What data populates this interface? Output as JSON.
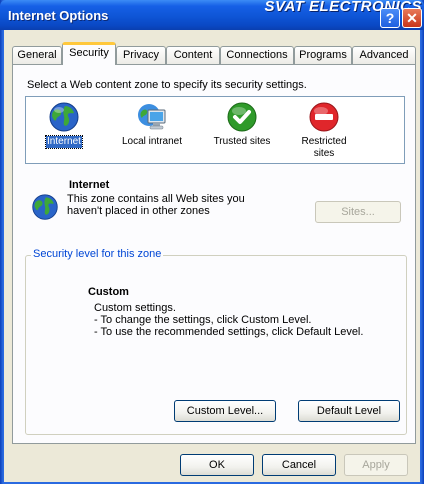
{
  "window": {
    "title": "Internet Options",
    "watermark": "SVAT ELECTRONICS",
    "help_glyph": "?",
    "close_glyph": "✕"
  },
  "tabs": [
    "General",
    "Security",
    "Privacy",
    "Content",
    "Connections",
    "Programs",
    "Advanced"
  ],
  "active_tab": "Security",
  "security": {
    "prompt": "Select a Web content zone to specify its security settings.",
    "zones": [
      {
        "label": "Internet",
        "icon": "globe-icon",
        "selected": true
      },
      {
        "label": "Local intranet",
        "icon": "intranet-monitor-icon",
        "selected": false
      },
      {
        "label": "Trusted sites",
        "icon": "check-circle-icon",
        "selected": false
      },
      {
        "label_line1": "Restricted",
        "label_line2": "sites",
        "icon": "no-entry-icon",
        "selected": false
      }
    ],
    "zone_title": "Internet",
    "zone_description_line1": "This zone contains all Web sites you",
    "zone_description_line2": "haven't placed in other zones",
    "sites_button": "Sites...",
    "level_group_title": "Security level for this zone",
    "level_name": "Custom",
    "level_line1": "Custom settings.",
    "level_line2": "- To change the settings, click Custom Level.",
    "level_line3": "- To use the recommended settings, click Default Level.",
    "custom_level_button": "Custom Level...",
    "default_level_button": "Default Level"
  },
  "footer": {
    "ok": "OK",
    "cancel": "Cancel",
    "apply": "Apply"
  },
  "colors": {
    "titlebar": "#0a48c4",
    "dialog_face": "#ece9d8",
    "selection": "#316ac5",
    "group_title": "#0046d5",
    "active_tab_highlight": "#ffc83c"
  }
}
